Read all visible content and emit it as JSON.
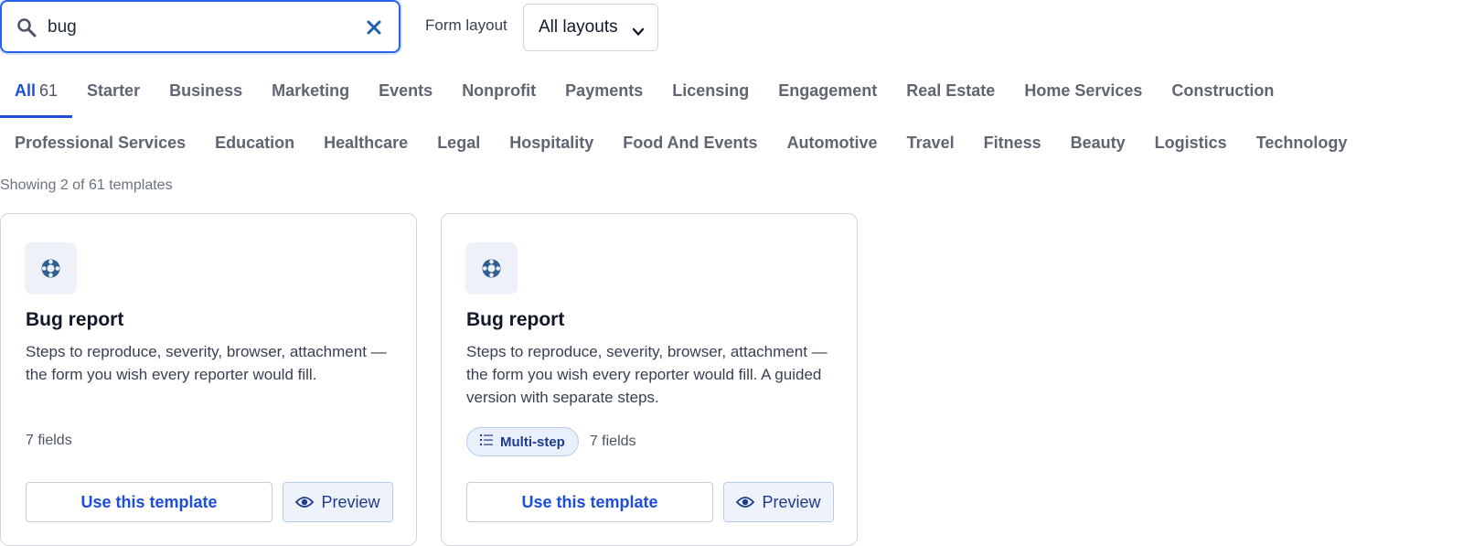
{
  "search": {
    "value": "bug"
  },
  "layout": {
    "label": "Form layout",
    "selected": "All layouts"
  },
  "tabs_row1": [
    {
      "label": "All",
      "count": "61",
      "active": true
    },
    {
      "label": "Starter"
    },
    {
      "label": "Business"
    },
    {
      "label": "Marketing"
    },
    {
      "label": "Events"
    },
    {
      "label": "Nonprofit"
    },
    {
      "label": "Payments"
    },
    {
      "label": "Licensing"
    },
    {
      "label": "Engagement"
    },
    {
      "label": "Real Estate"
    },
    {
      "label": "Home Services"
    },
    {
      "label": "Construction"
    }
  ],
  "tabs_row2": [
    {
      "label": "Professional Services"
    },
    {
      "label": "Education"
    },
    {
      "label": "Healthcare"
    },
    {
      "label": "Legal"
    },
    {
      "label": "Hospitality"
    },
    {
      "label": "Food And Events"
    },
    {
      "label": "Automotive"
    },
    {
      "label": "Travel"
    },
    {
      "label": "Fitness"
    },
    {
      "label": "Beauty"
    },
    {
      "label": "Logistics"
    },
    {
      "label": "Technology"
    }
  ],
  "showing": "Showing 2 of 61 templates",
  "cards": [
    {
      "icon": "lifebuoy-icon",
      "title": "Bug report",
      "description": "Steps to reproduce, severity, browser, attachment — the form you wish every reporter would fill.",
      "badge": "",
      "fields": "7 fields",
      "use_label": "Use this template",
      "preview_label": "Preview"
    },
    {
      "icon": "lifebuoy-icon",
      "title": "Bug report",
      "description": "Steps to reproduce, severity, browser, attachment — the form you wish every reporter would fill. A guided version with separate steps.",
      "badge": "Multi-step",
      "fields": "7 fields",
      "use_label": "Use this template",
      "preview_label": "Preview"
    }
  ],
  "colors": {
    "accent": "#1d4ed8",
    "focus_border": "#2563eb",
    "icon": "#2f5f93"
  }
}
